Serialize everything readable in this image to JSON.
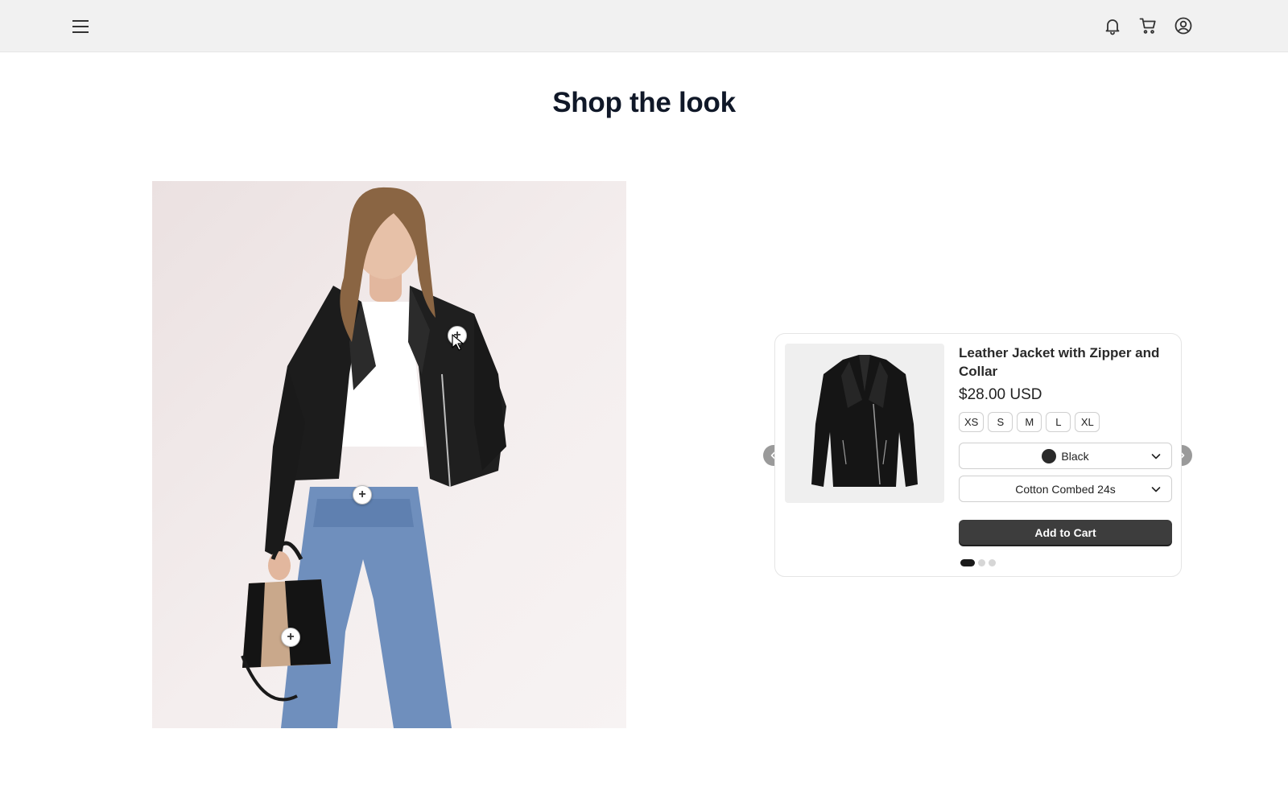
{
  "header": {
    "menu_icon": "hamburger-menu-icon",
    "icons": [
      "bell-icon",
      "cart-icon",
      "user-circle-icon"
    ]
  },
  "page": {
    "title": "Shop the look"
  },
  "look": {
    "image_alt": "Model wearing black leather jacket, white t-shirt, blue jeans and carrying a handbag",
    "hotspot_symbol": "+"
  },
  "product": {
    "name": "Leather Jacket with Zipper and Collar",
    "price": "$28.00 USD",
    "sizes": [
      "XS",
      "S",
      "M",
      "L",
      "XL"
    ],
    "color": {
      "label": "Black",
      "swatch": "#2a2a2a"
    },
    "material": "Cotton Combed 24s",
    "add_to_cart": "Add to Cart",
    "carousel": {
      "total": 3,
      "active": 1
    }
  },
  "colors": {
    "topbar_bg": "#f1f1f1",
    "title": "#101828",
    "button_bg": "#3d3d3d",
    "arrow_bg": "#9a9a9a"
  }
}
